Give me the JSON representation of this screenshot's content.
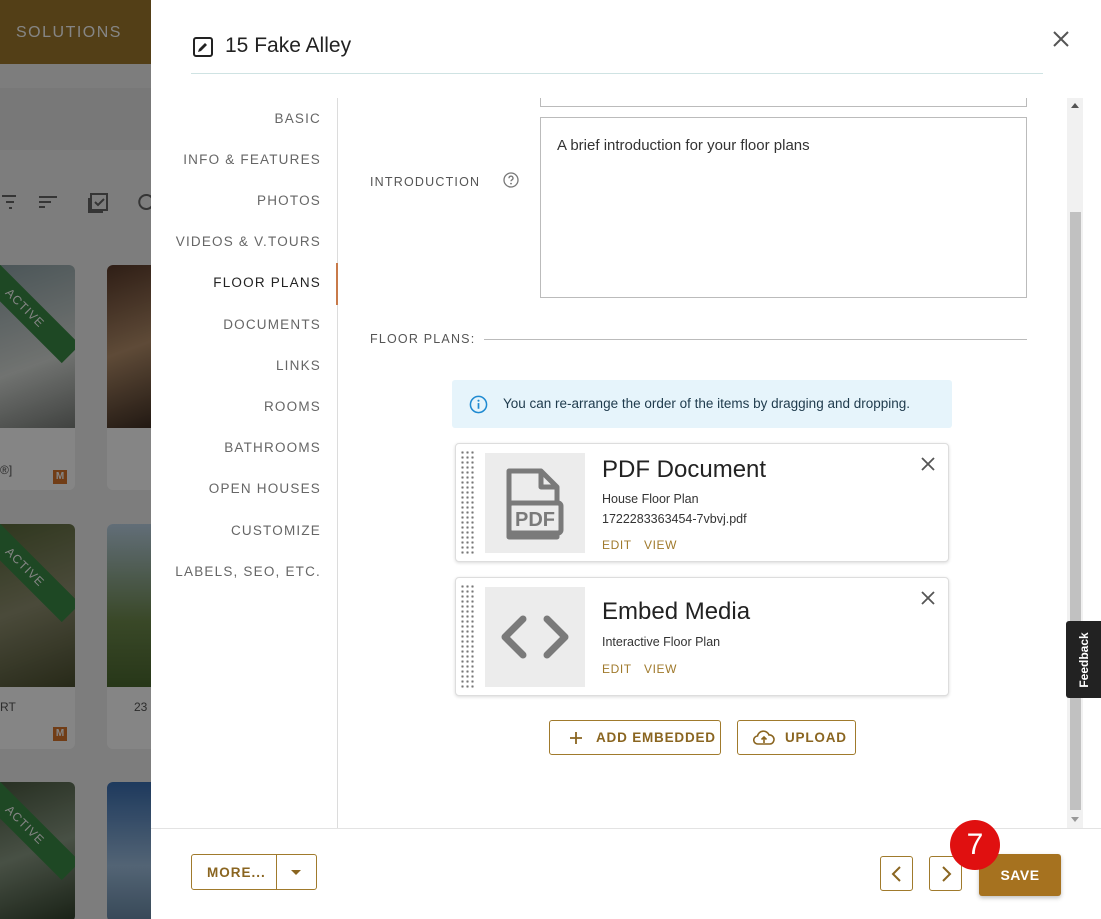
{
  "background": {
    "topbar_label": "SOLUTIONS",
    "card_text_1": "®]",
    "card_text_2": "RT",
    "card_text_3": "23",
    "ribbon_label": "ACTIVE",
    "m_badge": "M"
  },
  "modal": {
    "title": "15 Fake Alley",
    "nav": [
      {
        "label": "BASIC"
      },
      {
        "label": "INFO & FEATURES"
      },
      {
        "label": "PHOTOS"
      },
      {
        "label": "VIDEOS & V.TOURS"
      },
      {
        "label": "FLOOR PLANS",
        "active": true
      },
      {
        "label": "DOCUMENTS"
      },
      {
        "label": "LINKS"
      },
      {
        "label": "ROOMS"
      },
      {
        "label": "BATHROOMS"
      },
      {
        "label": "OPEN HOUSES"
      },
      {
        "label": "CUSTOMIZE"
      },
      {
        "label": "LABELS, SEO, ETC."
      }
    ],
    "introduction": {
      "label": "INTRODUCTION",
      "text": "A brief introduction for your floor plans"
    },
    "floor_plans_label": "FLOOR PLANS:",
    "info_message": "You can re-arrange the order of the items by dragging and dropping.",
    "items": [
      {
        "title": "PDF Document",
        "subtitle": "House Floor Plan",
        "filename": "1722283363454-7vbvj.pdf",
        "thumb_icon": "pdf-file-icon",
        "edit_label": "EDIT",
        "view_label": "VIEW"
      },
      {
        "title": "Embed Media",
        "subtitle": "Interactive Floor Plan",
        "thumb_icon": "code-brackets-icon",
        "edit_label": "EDIT",
        "view_label": "VIEW"
      }
    ],
    "add_embedded_label": "ADD EMBEDDED",
    "upload_label": "UPLOAD"
  },
  "footer": {
    "more_label": "MORE...",
    "save_label": "SAVE"
  },
  "step_badge": "7",
  "feedback_label": "Feedback",
  "colors": {
    "accent": "#a07a2c",
    "save": "#a6721f",
    "nav_active_bar": "#c87a4a",
    "info_bg": "#e6f4fb",
    "badge": "#e01010"
  }
}
